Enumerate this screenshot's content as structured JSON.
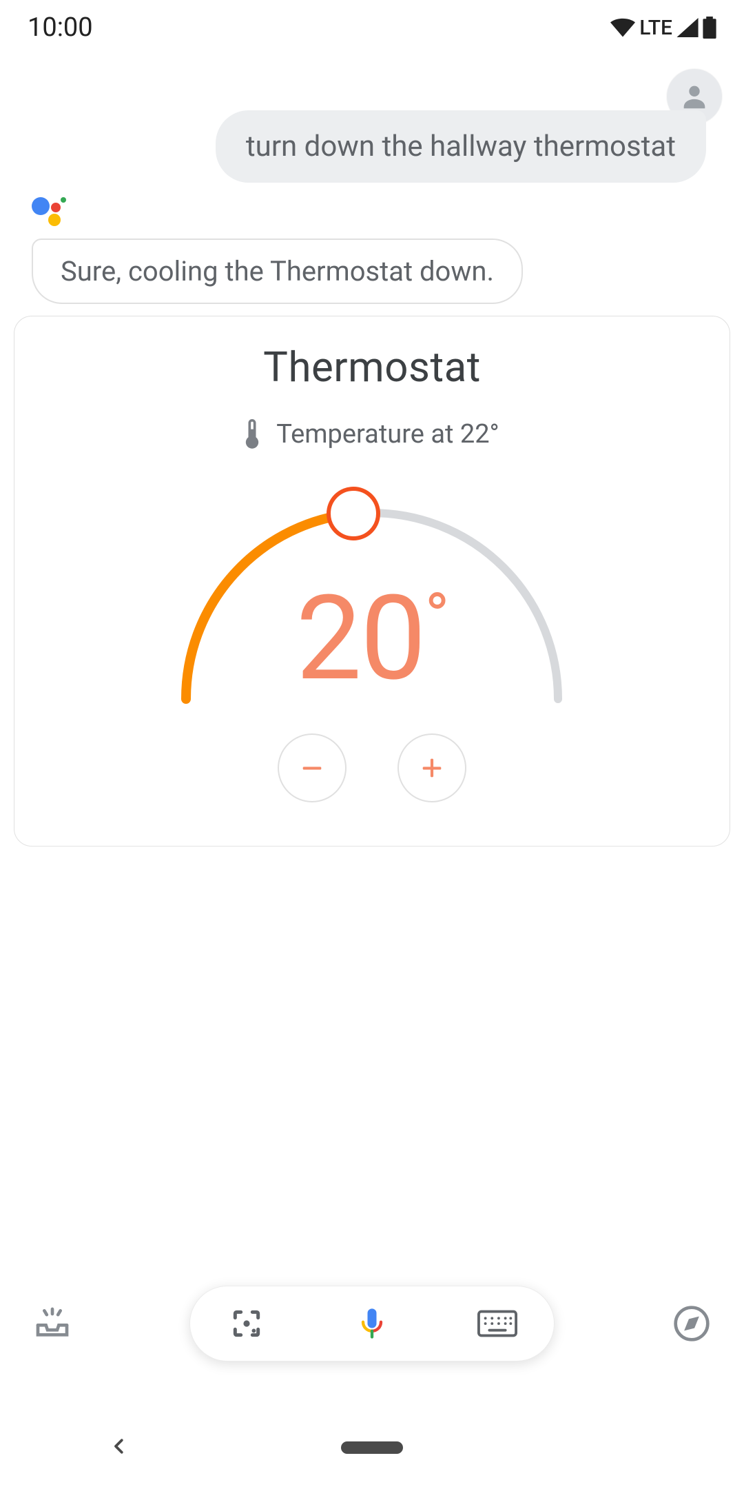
{
  "status": {
    "time": "10:00",
    "network": "LTE"
  },
  "user_query": "turn down the hallway thermostat",
  "assistant_reply": "Sure, cooling the Thermostat down.",
  "card": {
    "title": "Thermostat",
    "current_temp_label": "Temperature at 22°",
    "set_temp_value": "20",
    "set_temp_degree": "°"
  },
  "colors": {
    "accent_orange": "#fb8c00",
    "temp_text": "#f58967",
    "grey_text": "#5f6368"
  }
}
